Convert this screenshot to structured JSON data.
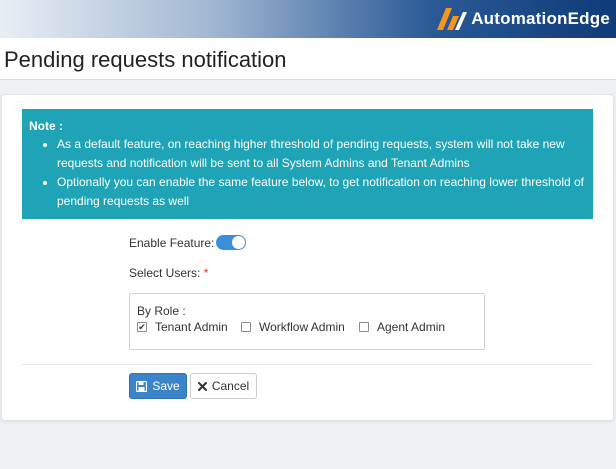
{
  "brand": {
    "name": "AutomationEdge",
    "logo_icon": "ae-logo-icon",
    "accent": "#f7941d"
  },
  "page": {
    "title": "Pending requests notification"
  },
  "note": {
    "title": "Note :",
    "items": [
      "As a default feature, on reaching higher threshold of pending requests, system will not take new requests and notification will be sent to all System Admins and Tenant Admins",
      "Optionally you can enable the same feature below, to get notification on reaching lower threshold of pending requests as well"
    ],
    "bg_color": "#1ea4b6"
  },
  "form": {
    "enable_feature_label": "Enable Feature:",
    "enable_feature_on": true,
    "select_users_label": "Select Users:",
    "required_mark": "*",
    "by_role_label": "By Role :",
    "roles": [
      {
        "label": "Tenant Admin",
        "checked": true
      },
      {
        "label": "Workflow Admin",
        "checked": false
      },
      {
        "label": "Agent Admin",
        "checked": false
      }
    ]
  },
  "buttons": {
    "save_label": "Save",
    "save_icon": "floppy-disk-icon",
    "cancel_label": "Cancel",
    "cancel_icon": "close-icon"
  },
  "colors": {
    "primary": "#3a84c9",
    "toggle_on": "#3b8ed8",
    "header_dark": "#0f3b78"
  }
}
